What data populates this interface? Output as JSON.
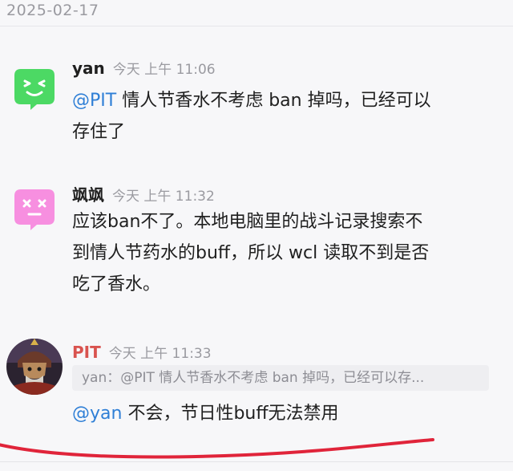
{
  "date_header": "2025-02-17",
  "messages": [
    {
      "sender": "yan",
      "time": "今天 上午 11:06",
      "avatar_icon": "green-smiley-square-icon",
      "avatar_color": "#4cd964",
      "lines": [
        {
          "mention": "@PIT",
          "text": " 情人节香水不考虑 ban 掉吗，已经可以"
        },
        {
          "mention": "",
          "text": "存住了"
        }
      ]
    },
    {
      "sender": "飒飒",
      "time": "今天 上午 11:32",
      "avatar_icon": "pink-dizzy-square-icon",
      "avatar_color": "#f78fe0",
      "lines": [
        {
          "mention": "",
          "text": "应该ban不了。本地电脑里的战斗记录搜索不"
        },
        {
          "mention": "",
          "text": "到情人节药水的buff，所以 wcl 读取不到是否"
        },
        {
          "mention": "",
          "text": "吃了香水。"
        }
      ]
    },
    {
      "sender": "PIT",
      "time": "今天 上午 11:33",
      "avatar_icon": "warrior-portrait-icon",
      "sender_color": "#d9534f",
      "quote": "yan：@PIT 情人节香水不考虑 ban 掉吗，已经可以存...",
      "lines": [
        {
          "mention": "@yan",
          "text": " 不会，节日性buff无法禁用"
        }
      ]
    }
  ],
  "colors": {
    "mention": "#2f7fd6",
    "highlight_stroke": "#e0243a"
  }
}
